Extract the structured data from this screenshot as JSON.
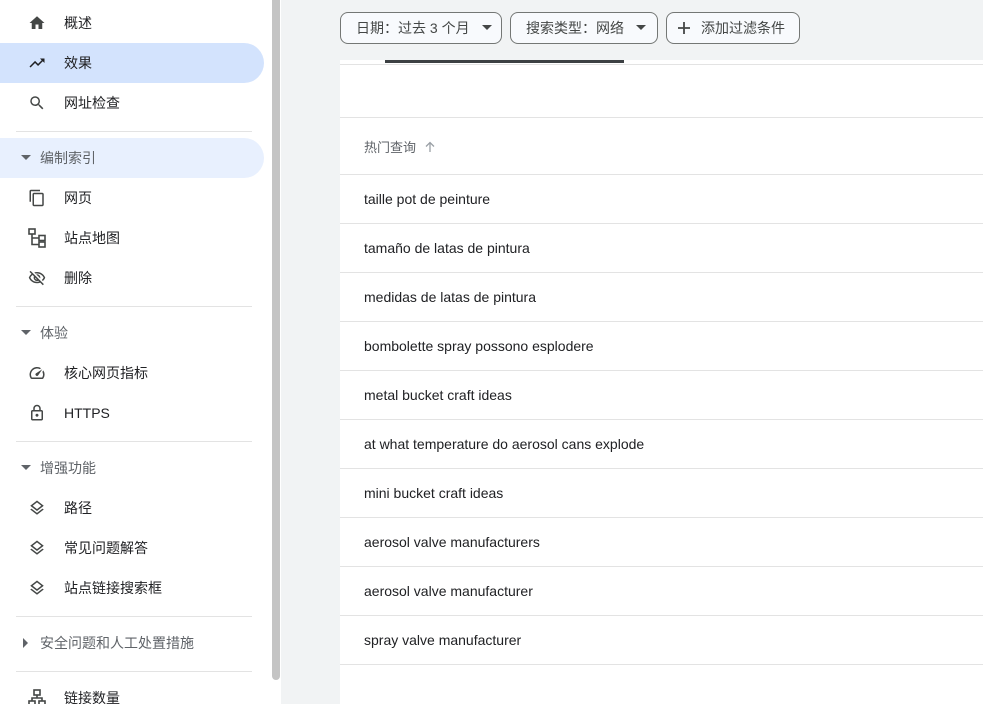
{
  "sidebar": {
    "top_items": [
      {
        "label": "概述",
        "icon": "home-icon"
      },
      {
        "label": "效果",
        "icon": "trending-up-icon",
        "active": true
      },
      {
        "label": "网址检查",
        "icon": "search-icon"
      }
    ],
    "sections": [
      {
        "title": "编制索引",
        "expanded": true,
        "items": [
          {
            "label": "网页",
            "icon": "pages-icon"
          },
          {
            "label": "站点地图",
            "icon": "sitemap-icon"
          },
          {
            "label": "删除",
            "icon": "visibility-off-icon"
          }
        ]
      },
      {
        "title": "体验",
        "expanded": true,
        "items": [
          {
            "label": "核心网页指标",
            "icon": "speed-gauge-icon"
          },
          {
            "label": "HTTPS",
            "icon": "lock-icon"
          }
        ]
      },
      {
        "title": "增强功能",
        "expanded": true,
        "items": [
          {
            "label": "路径",
            "icon": "layers-icon"
          },
          {
            "label": "常见问题解答",
            "icon": "layers-icon"
          },
          {
            "label": "站点链接搜索框",
            "icon": "layers-icon"
          }
        ]
      },
      {
        "title": "安全问题和人工处置措施",
        "expanded": false,
        "items": []
      }
    ],
    "bottom_item": {
      "label": "链接数量",
      "icon": "links-tree-icon"
    }
  },
  "filters": {
    "date_chip": "日期：过去 3 个月",
    "search_type_chip": "搜索类型：网络",
    "add_filter": "添加过滤条件"
  },
  "table": {
    "column_header": "热门查询",
    "rows": [
      "taille pot de peinture",
      "tamaño de latas de pintura",
      "medidas de latas de pintura",
      "bombolette spray possono esplodere",
      "metal bucket craft ideas",
      "at what temperature do aerosol cans explode",
      "mini bucket craft ideas",
      "aerosol valve manufacturers",
      "aerosol valve manufacturer",
      "spray valve manufacturer"
    ]
  },
  "colors": {
    "active_nav": "#d3e3fd",
    "section_active": "#e8f0fe",
    "background": "#f1f3f4"
  }
}
